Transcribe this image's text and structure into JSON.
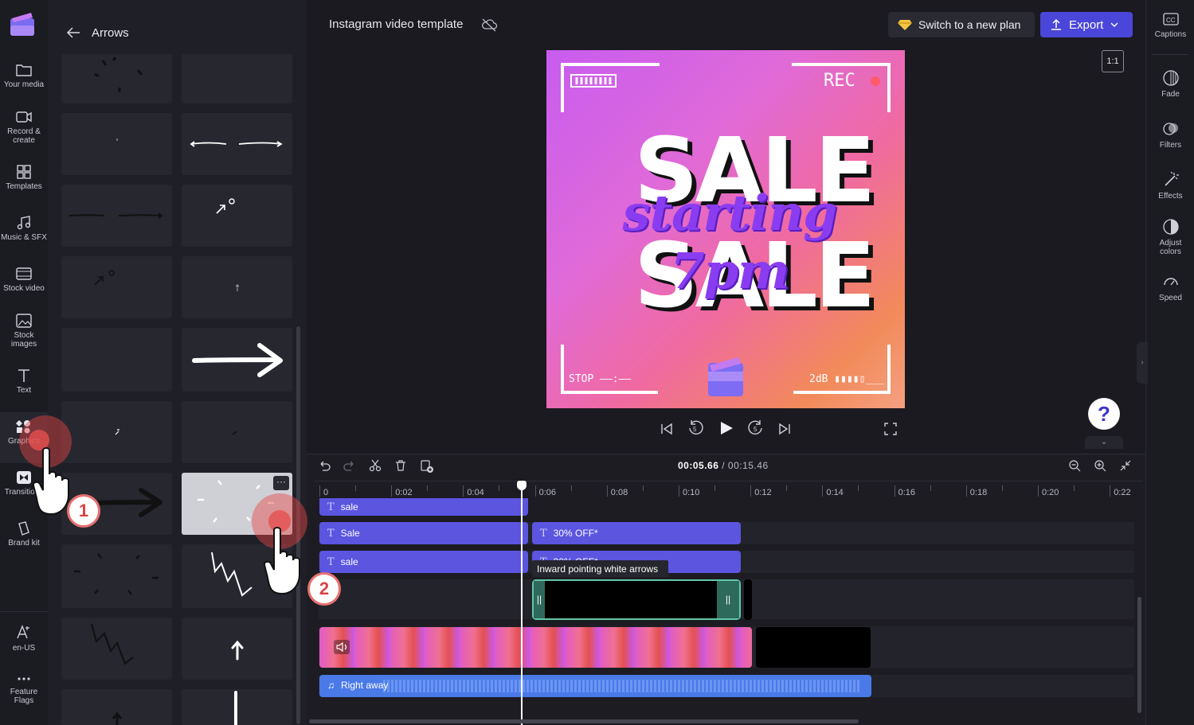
{
  "rail": {
    "items": [
      {
        "label": "Your media",
        "icon": "folder-icon"
      },
      {
        "label": "Record & create",
        "icon": "camera-icon"
      },
      {
        "label": "Templates",
        "icon": "templates-icon"
      },
      {
        "label": "Music & SFX",
        "icon": "music-icon"
      },
      {
        "label": "Stock video",
        "icon": "film-icon"
      },
      {
        "label": "Stock images",
        "icon": "image-icon"
      },
      {
        "label": "Text",
        "icon": "text-icon"
      },
      {
        "label": "Graphics",
        "icon": "shapes-icon"
      },
      {
        "label": "Transitions",
        "icon": "transitions-icon"
      },
      {
        "label": "Brand kit",
        "icon": "brand-icon"
      },
      {
        "label": "en-US",
        "icon": "language-icon"
      },
      {
        "label": "Feature Flags",
        "icon": "more-icon"
      }
    ]
  },
  "panel": {
    "title": "Arrows",
    "back_icon": "arrow-left-icon"
  },
  "header": {
    "project_title": "Instagram video template",
    "cloud_icon": "cloud-off-icon",
    "upgrade_label": "Switch to a new plan",
    "export_label": "Export",
    "aspect_ratio": "1:1"
  },
  "preview": {
    "rec_label": "REC",
    "stop_label": "STOP ––:––",
    "db_label": "2dB",
    "sale_text": "SALE",
    "script_text": "starting 7pm"
  },
  "playback": {
    "current_time": "00:05.66",
    "total_time": "00:15.46",
    "separator": "/"
  },
  "help": {
    "label": "?"
  },
  "right_rail": {
    "items": [
      {
        "label": "Captions",
        "icon": "captions-icon"
      },
      {
        "label": "Fade",
        "icon": "fade-icon"
      },
      {
        "label": "Filters",
        "icon": "filters-icon"
      },
      {
        "label": "Effects",
        "icon": "effects-icon"
      },
      {
        "label": "Adjust colors",
        "icon": "adjust-icon"
      },
      {
        "label": "Speed",
        "icon": "speed-icon"
      }
    ]
  },
  "ruler": {
    "labels": [
      "0",
      "0:02",
      "0:04",
      "0:06",
      "0:08",
      "0:10",
      "0:12",
      "0:14",
      "0:16",
      "0:18",
      "0:20",
      "0:22"
    ]
  },
  "tracks": {
    "sale_top": "sale",
    "sale_mid": "Sale",
    "sale_low": "sale",
    "off_top": "30% OFF*",
    "off_low": "30% OFF*",
    "tooltip": "Inward pointing white arrows",
    "audio": "Right away"
  },
  "steps": {
    "one": "1",
    "two": "2"
  },
  "colors": {
    "accent": "#5b55e0",
    "export": "#4a46d9",
    "clip": "#5b55e0",
    "audio": "#4a7ae8"
  }
}
